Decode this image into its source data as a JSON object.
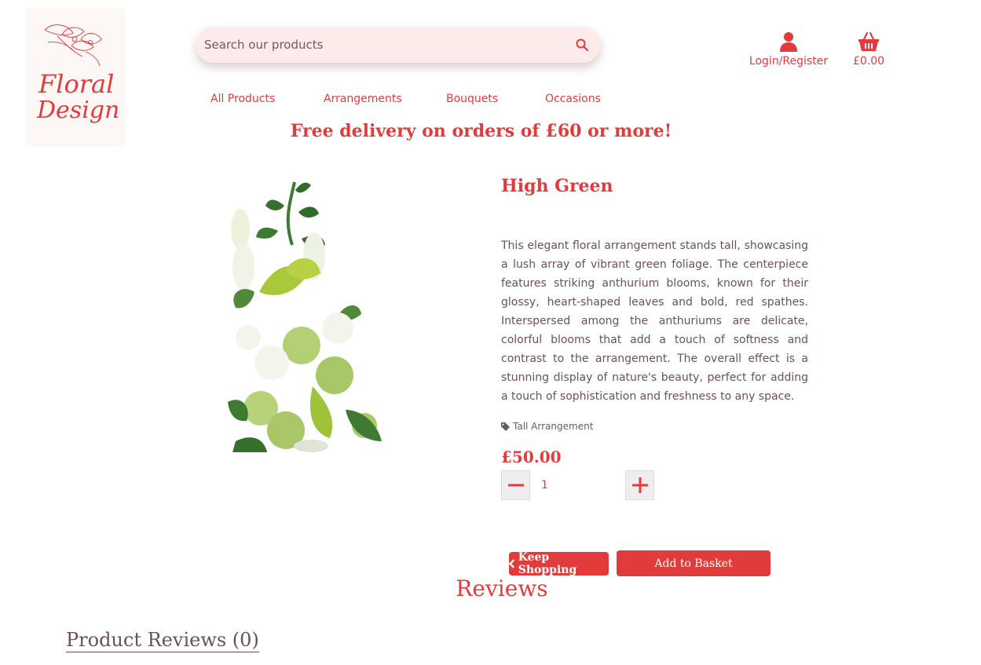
{
  "brand": {
    "logo_line1": "Floral",
    "logo_line2": "Design",
    "accent": "#e23b3b",
    "logo_bg": "#fdf7f5"
  },
  "search": {
    "placeholder": "Search our products",
    "icon": "search-icon"
  },
  "account": {
    "login_label": "Login/Register",
    "icon": "user-icon"
  },
  "basket": {
    "total": "£0.00",
    "icon": "basket-icon"
  },
  "nav": {
    "items": [
      {
        "label": "All Products"
      },
      {
        "label": "Arrangements"
      },
      {
        "label": "Bouquets"
      },
      {
        "label": "Occasions"
      }
    ]
  },
  "banner": {
    "text": "Free delivery on orders of £60 or more!"
  },
  "product": {
    "title": "High Green",
    "description": "This elegant floral arrangement stands tall, showcasing a lush array of vibrant green foliage. The centerpiece features striking anthurium blooms, known for their glossy, heart-shaped leaves and bold, red spathes. Interspersed among the anthuriums are delicate, colorful blooms that add a touch of softness and contrast to the arrangement. The overall effect is a stunning display of nature's beauty, perfect for adding a touch of sophistication and freshness to any space.",
    "tag": "Tall Arrangement",
    "price": "£50.00",
    "quantity": "1"
  },
  "actions": {
    "keep_shopping": "Keep Shopping",
    "add_to_basket": "Add to Basket"
  },
  "reviews": {
    "heading": "Reviews",
    "product_reviews": "Product Reviews (0)"
  }
}
